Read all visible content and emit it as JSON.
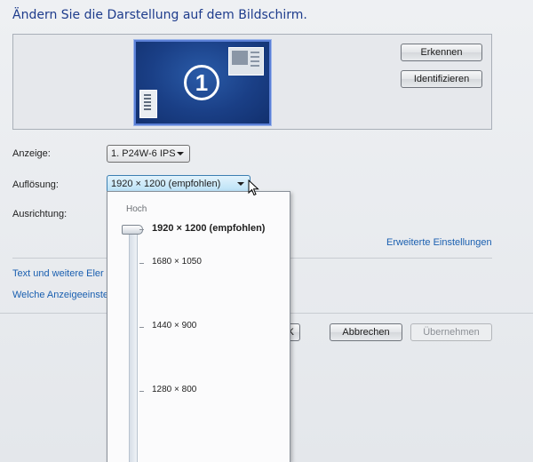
{
  "page": {
    "heading": "Ändern Sie die Darstellung auf dem Bildschirm."
  },
  "monitor_panel": {
    "monitor_number": "1",
    "detect_button": "Erkennen",
    "identify_button": "Identifizieren"
  },
  "settings": {
    "display_label": "Anzeige:",
    "display_value": "1. P24W-6 IPS",
    "resolution_label": "Auflösung:",
    "resolution_value": "1920 × 1200 (empfohlen)",
    "orientation_label": "Ausrichtung:",
    "advanced_link": "Erweiterte Einstellungen"
  },
  "links": {
    "text_size": "Text und weitere Eler",
    "display_settings": "Welche Anzeigeeinste"
  },
  "footer": {
    "ok_partial": "K",
    "cancel_button": "Abbrechen",
    "apply_button": "Übernehmen"
  },
  "resolution_dropdown": {
    "high_label": "Hoch",
    "options": [
      "1920 × 1200 (empfohlen)",
      "1680 × 1050",
      "1440 × 900",
      "1280 × 800"
    ],
    "selected_index": 0
  },
  "colors": {
    "heading": "#1e3c8c",
    "link": "#1a5fb0",
    "monitor": "#1a3f86"
  }
}
